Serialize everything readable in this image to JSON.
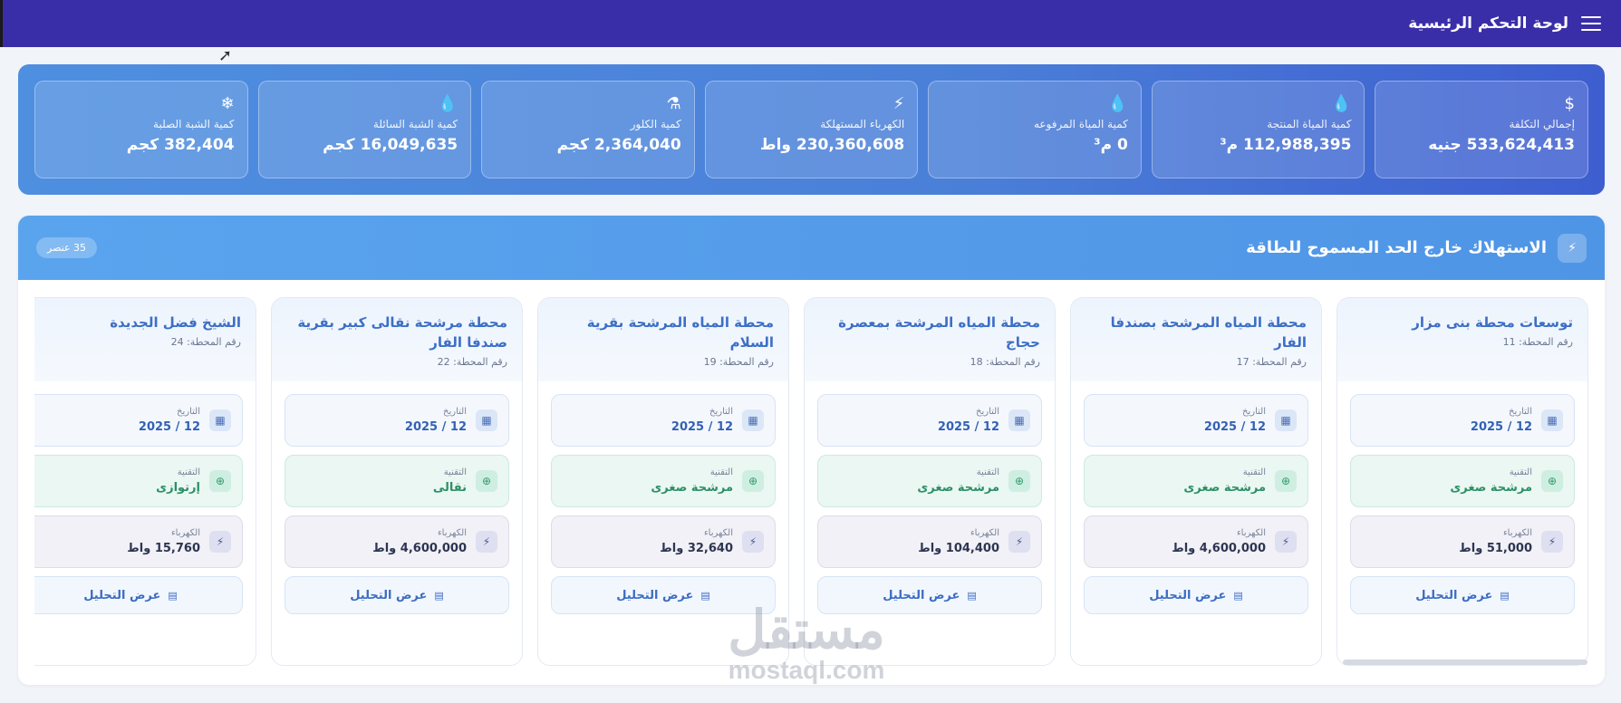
{
  "topbar": {
    "title": "لوحة التحكم الرئيسية"
  },
  "stats": [
    {
      "icon": "dollar-icon",
      "glyph": "$",
      "label": "إجمالي التكلفة",
      "value": "533,624,413 جنيه"
    },
    {
      "icon": "drop-icon",
      "glyph": "💧",
      "label": "كمية المياة المنتجة",
      "value": "112,988,395 م³"
    },
    {
      "icon": "drop-icon",
      "glyph": "💧",
      "label": "كمية المياة المرفوعه",
      "value": "0 م³"
    },
    {
      "icon": "plug-icon",
      "glyph": "⚡",
      "label": "الكهرباء المستهلكة",
      "value": "230,360,608 واط"
    },
    {
      "icon": "flask-icon",
      "glyph": "⚗",
      "label": "كمية الكلور",
      "value": "2,364,040 كجم"
    },
    {
      "icon": "drop-icon",
      "glyph": "💧",
      "label": "كمية الشبة السائلة",
      "value": "16,049,635 كجم"
    },
    {
      "icon": "snowflake-icon",
      "glyph": "❄",
      "label": "كمية الشبة الصلبة",
      "value": "382,404 كجم"
    }
  ],
  "section": {
    "title": "الاستهلاك خارج الحد المسموح للطاقة",
    "badge": "35 عنصر"
  },
  "labels": {
    "date": "التاريخ",
    "tech": "التقنية",
    "elec": "الكهرباء",
    "analysis": "عرض التحليل"
  },
  "stations": [
    {
      "name": "توسعات محطة بنى مزار",
      "number": "رقم المحطة: 11",
      "date": "12 / 2025",
      "tech": "مرشحة صغرى",
      "elec": "51,000 واط"
    },
    {
      "name": "محطة المياه المرشحة بصندفا الفار",
      "number": "رقم المحطة: 17",
      "date": "12 / 2025",
      "tech": "مرشحة صغرى",
      "elec": "4,600,000 واط"
    },
    {
      "name": "محطة المياه المرشحة بمعصرة حجاج",
      "number": "رقم المحطة: 18",
      "date": "12 / 2025",
      "tech": "مرشحة صغرى",
      "elec": "104,400 واط"
    },
    {
      "name": "محطة المياه المرشحة بقرية السلام",
      "number": "رقم المحطة: 19",
      "date": "12 / 2025",
      "tech": "مرشحة صغرى",
      "elec": "32,640 واط"
    },
    {
      "name": "محطة مرشحة نقالى كبير بقرية صندفا الفار",
      "number": "رقم المحطة: 22",
      "date": "12 / 2025",
      "tech": "نقالى",
      "elec": "4,600,000 واط"
    },
    {
      "name": "الشيخ فضل الجديدة",
      "number": "رقم المحطة: 24",
      "date": "12 / 2025",
      "tech": "إرتوازى",
      "elec": "15,760 واط"
    }
  ],
  "watermark": {
    "line1": "مستقل",
    "line2": "mostaql.com"
  }
}
